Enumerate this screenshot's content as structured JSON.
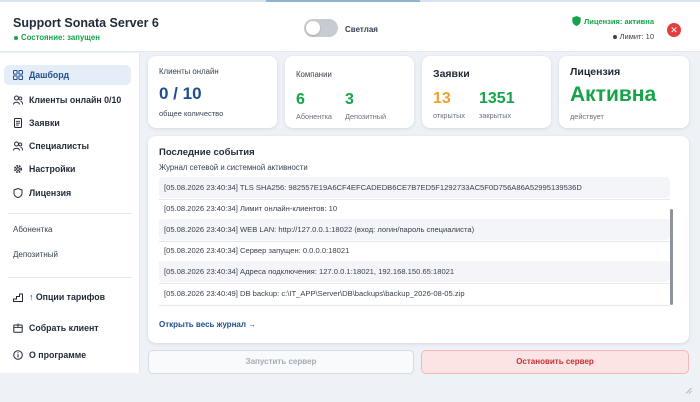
{
  "header": {
    "app_title": "Support Sonata Server 6",
    "state": "Состояние: запущен",
    "theme_label": "Светлая",
    "license_status": "Лицензия: активна",
    "limit": "Лимит: 10",
    "close_glyph": "✕"
  },
  "sidebar": {
    "items": [
      {
        "label": "Дашборд",
        "icon": "grid-icon",
        "active": true
      },
      {
        "label": "Клиенты онлайн 0/10",
        "icon": "users-icon"
      },
      {
        "label": "Заявки",
        "icon": "document-icon"
      },
      {
        "label": "Специалисты",
        "icon": "users-icon"
      },
      {
        "label": "Настройки",
        "icon": "gear-icon"
      },
      {
        "label": "Лицензия",
        "icon": "shield-icon"
      }
    ],
    "tariff_labels": [
      "Абонентка",
      "Депозитный"
    ],
    "bottom_items": [
      {
        "label": "↑ Опции тарифов",
        "icon": "stairs-icon"
      },
      {
        "label": "Собрать клиент",
        "icon": "package-icon"
      },
      {
        "label": "О программе",
        "icon": "info-icon"
      }
    ]
  },
  "cards": {
    "clients": {
      "title": "Клиенты онлайн",
      "value": "0 / 10",
      "caption": "общее количество"
    },
    "companies": {
      "title": "Компании",
      "subscription_value": "6",
      "subscription_label": "Абонентка",
      "deposit_value": "3",
      "deposit_label": "Депозитный"
    },
    "tickets": {
      "title": "Заявки",
      "open_value": "13",
      "open_label": "открытых",
      "closed_value": "1351",
      "closed_label": "закрытых"
    },
    "license": {
      "title": "Лицензия",
      "value": "Активна",
      "caption": "действует"
    }
  },
  "events": {
    "title": "Последние события",
    "subtitle": "Журнал сетевой и системной активности",
    "log": [
      "[05.08.2026 23:40:34] TLS SHA256: 982557E19A6CF4EFCADEDB6CE7B7ED5F1292733AC5F0D756A86A52995139536D",
      "[05.08.2026 23:40:34] Лимит онлайн-клиентов: 10",
      "[05.08.2026 23:40:34] WEB LAN: http://127.0.0.1:18022 (вход: логин/пароль специалиста)",
      "[05.08.2026 23:40:34] Сервер запущен: 0.0.0.0:18021",
      "[05.08.2026 23:40:34] Адреса подключения: 127.0.0.1:18021, 192.168.150.65:18021",
      "[05.08.2026 23:40:49] DB backup: c:\\IT_APP\\Server\\DB\\backups\\backup_2026-08-05.zip"
    ],
    "open_link": "Открыть весь журнал →"
  },
  "actions": {
    "start": "Запустить сервер",
    "stop": "Остановить сервер"
  },
  "colors": {
    "accent": "#1d4f91",
    "success": "#16a34a",
    "warning": "#f0a12b",
    "danger": "#e53e3e"
  }
}
